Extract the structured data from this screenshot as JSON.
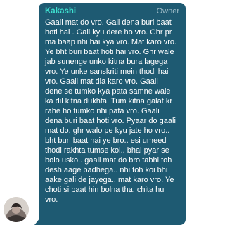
{
  "message": {
    "sender": "Kakashi",
    "role": "Owner",
    "lines": [
      "Gaali mat do vro. Gali dena buri baat",
      "hoti hai . Gali kyu dere ho vro. Ghr pr",
      "ma baap nhi hai kya vro. Mat karo vro.",
      "Ye bht buri baat hoti hai vro. Ghr wale",
      "jab sunenge unko kitna bura lagega",
      "vro. Ye unke sanskriti mein thodi hai",
      "vro. Gaali mat dia karo vro. Gaali",
      "dene se tumko kya pata samne wale",
      "ka dil kitna dukhta. Tum kitna galat kr",
      "rahe ho tumko nhi pata vro. Gaali",
      "dena buri baat hoti vro. Pyaar do gaali",
      "mat do. ghr walo pe kyu jate ho vro..",
      "bht buri baat hai ye bro.. esi umeed",
      "thodi rakhta tumse koi.. bhai pyar se",
      "bolo usko.. gaali mat do bro tabhi toh",
      "desh aage badhega.. nhi toh koi bhi",
      "aake gali de jayega.. mat karo vro. Ye",
      "choti si baat hin bolna tha, chita hu",
      "vro."
    ]
  },
  "colors": {
    "bubble": "#1e5a72",
    "sender": "#3ee0cf",
    "role": "#9fbcc8",
    "text": "#ffffff"
  }
}
